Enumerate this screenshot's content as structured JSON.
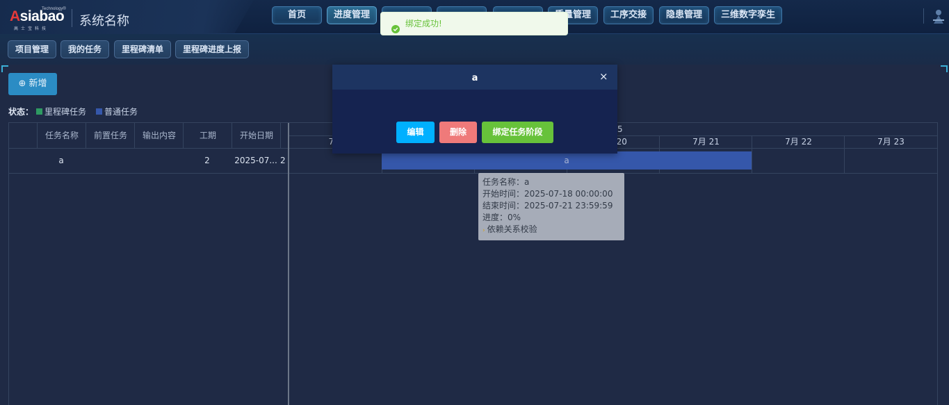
{
  "header": {
    "logo_text": "Asiabao",
    "logo_tech": "Technology®",
    "logo_sub": "高士宝科技",
    "system_name": "系统名称",
    "nav": [
      {
        "label": "首页"
      },
      {
        "label": "进度管理"
      },
      {
        "label": ""
      },
      {
        "label": ""
      },
      {
        "label": ""
      },
      {
        "label": "质量管理"
      },
      {
        "label": "工序交接"
      },
      {
        "label": "隐患管理"
      },
      {
        "label": "三维数字孪生"
      }
    ]
  },
  "subnav": [
    {
      "label": "项目管理"
    },
    {
      "label": "我的任务"
    },
    {
      "label": "里程碑清单"
    },
    {
      "label": "里程碑进度上报"
    }
  ],
  "toolbar": {
    "add_label": "新增"
  },
  "legend": {
    "title": "状态：",
    "items": [
      {
        "label": "里程碑任务",
        "color": "#2e9a62"
      },
      {
        "label": "普通任务",
        "color": "#3557aa"
      }
    ]
  },
  "grid": {
    "columns": [
      "任务名称",
      "前置任务",
      "输出内容",
      "工期",
      "开始日期"
    ],
    "rows": [
      {
        "name": "a",
        "predecessor": "",
        "output": "",
        "duration": "2",
        "start": "2025-07...",
        "end_peek": "2"
      }
    ]
  },
  "timeline": {
    "top_label": "5",
    "days": [
      "7月",
      "",
      "",
      "7月 20",
      "7月 21",
      "7月 22",
      "7月 23"
    ]
  },
  "task_bar": {
    "label": "a"
  },
  "tooltip": {
    "name": "任务名称：a",
    "start": "开始时间：2025-07-18 00:00:00",
    "end": "结束时间：2025-07-21 23:59:59",
    "progress": "进度：0%",
    "dependency": "依赖关系校验"
  },
  "modal": {
    "title": "a",
    "close": "×",
    "edit_label": "编辑",
    "delete_label": "删除",
    "bind_label": "绑定任务阶段"
  },
  "toast": {
    "message": "绑定成功!"
  },
  "colors": {
    "accent": "#2b8cc4",
    "edit": "#00b0ff",
    "delete": "#ef7a7a",
    "bind": "#67c23a",
    "success": "#67c23a"
  }
}
